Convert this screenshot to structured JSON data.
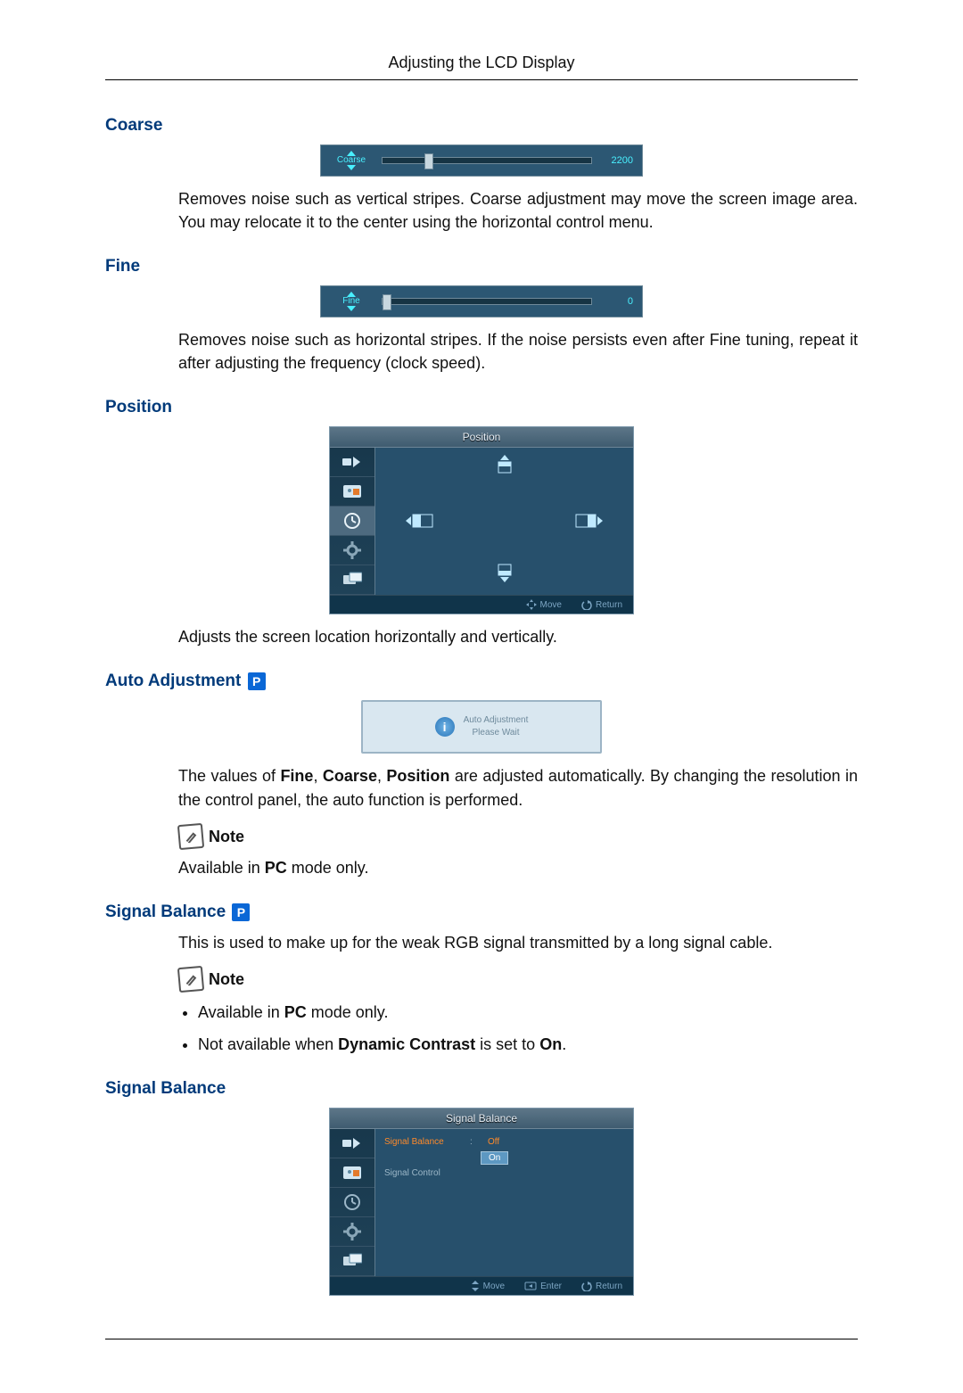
{
  "page": {
    "header": "Adjusting the LCD Display"
  },
  "coarse": {
    "title": "Coarse",
    "slider_label": "Coarse",
    "slider_value": "2200",
    "desc": "Removes noise such as vertical stripes. Coarse adjustment may move the screen image area. You may relocate it to the center using the horizontal control menu."
  },
  "fine": {
    "title": "Fine",
    "slider_label": "Fine",
    "slider_value": "0",
    "desc": "Removes noise such as horizontal stripes. If the noise persists even after Fine tuning, repeat it after adjusting the frequency (clock speed)."
  },
  "position": {
    "title": "Position",
    "osd_title": "Position",
    "hint_move": "Move",
    "hint_return": "Return",
    "desc": "Adjusts the screen location horizontally and vertically."
  },
  "auto": {
    "title": "Auto Adjustment",
    "badge": "P",
    "dialog_line1": "Auto Adjustment",
    "dialog_line2": "Please Wait",
    "desc_pre": "The values of ",
    "desc_b1": "Fine",
    "desc_mid1": ", ",
    "desc_b2": "Coarse",
    "desc_mid2": ", ",
    "desc_b3": "Position",
    "desc_post": " are adjusted automatically. By changing the resolution in the control panel, the auto function is performed.",
    "note_label": "Note",
    "note_pre": "Available in ",
    "note_b": "PC",
    "note_post": " mode only."
  },
  "sigbal_intro": {
    "title": "Signal Balance",
    "badge": "P",
    "desc": "This is used to make up for the weak RGB signal transmitted by a long signal cable.",
    "note_label": "Note",
    "bullet1_pre": "Available in ",
    "bullet1_b": "PC",
    "bullet1_post": " mode only.",
    "bullet2_pre": "Not available when ",
    "bullet2_b1": "Dynamic Contrast",
    "bullet2_mid": " is set to ",
    "bullet2_b2": "On",
    "bullet2_post": "."
  },
  "sigbal_menu": {
    "title": "Signal Balance",
    "osd_title": "Signal Balance",
    "row1": "Signal Balance",
    "row2": "Signal Control",
    "opt_off": "Off",
    "opt_on": "On",
    "hint_move": "Move",
    "hint_enter": "Enter",
    "hint_return": "Return"
  },
  "icons": {
    "p_badge": "P"
  }
}
